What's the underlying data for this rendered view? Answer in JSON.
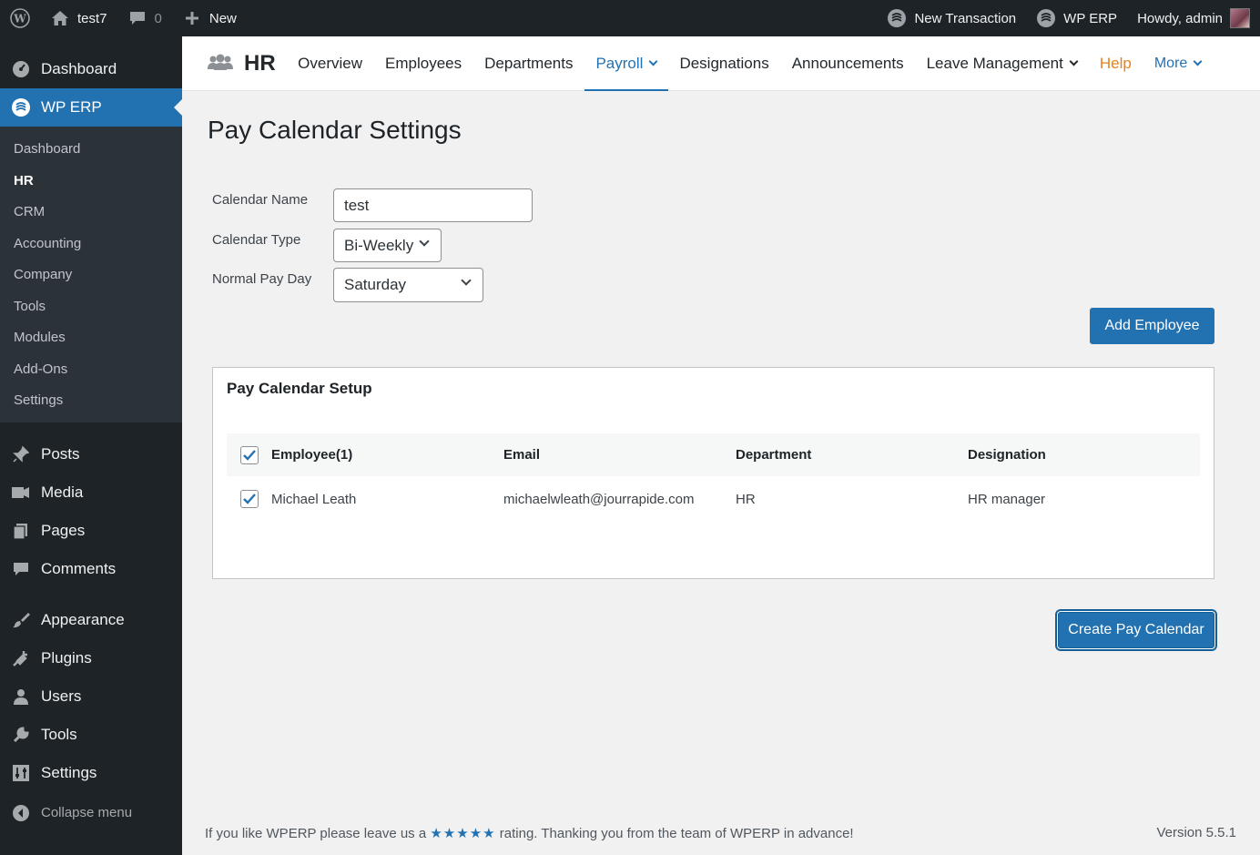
{
  "adminbar": {
    "site_name": "test7",
    "comments_count": "0",
    "new_label": "New",
    "new_transaction": "New Transaction",
    "wp_erp": "WP ERP",
    "howdy": "Howdy, admin"
  },
  "sidebar": {
    "dashboard": "Dashboard",
    "wp_erp": "WP ERP",
    "submenu": [
      "Dashboard",
      "HR",
      "CRM",
      "Accounting",
      "Company",
      "Tools",
      "Modules",
      "Add-Ons",
      "Settings"
    ],
    "posts": "Posts",
    "media": "Media",
    "pages": "Pages",
    "comments": "Comments",
    "appearance": "Appearance",
    "plugins": "Plugins",
    "users": "Users",
    "tools": "Tools",
    "settings": "Settings",
    "collapse": "Collapse menu"
  },
  "hrnav": {
    "title": "HR",
    "items": [
      "Overview",
      "Employees",
      "Departments",
      "Payroll",
      "Designations",
      "Announcements",
      "Leave Management",
      "Help",
      "More"
    ]
  },
  "page": {
    "title": "Pay Calendar Settings",
    "calendar_name_label": "Calendar Name",
    "calendar_name_value": "test",
    "calendar_type_label": "Calendar Type",
    "calendar_type_value": "Bi-Weekly",
    "pay_day_label": "Normal Pay Day",
    "pay_day_value": "Saturday",
    "add_employee": "Add Employee",
    "create_pay_calendar": "Create Pay Calendar"
  },
  "setup": {
    "title": "Pay Calendar Setup",
    "headers": [
      "Employee(1)",
      "Email",
      "Department",
      "Designation"
    ],
    "rows": [
      {
        "name": "Michael Leath",
        "email": "michaelwleath@jourrapide.com",
        "department": "HR",
        "designation": "HR manager"
      }
    ]
  },
  "footer": {
    "left_pre": "If you like WPERP please leave us a",
    "stars": "★★★★★",
    "left_post": "rating. Thanking you from the team of WPERP in advance!",
    "version": "Version 5.5.1"
  },
  "colors": {
    "accent": "#2271b1",
    "adminbar_bg": "#1d2327",
    "help": "#e6811a"
  }
}
